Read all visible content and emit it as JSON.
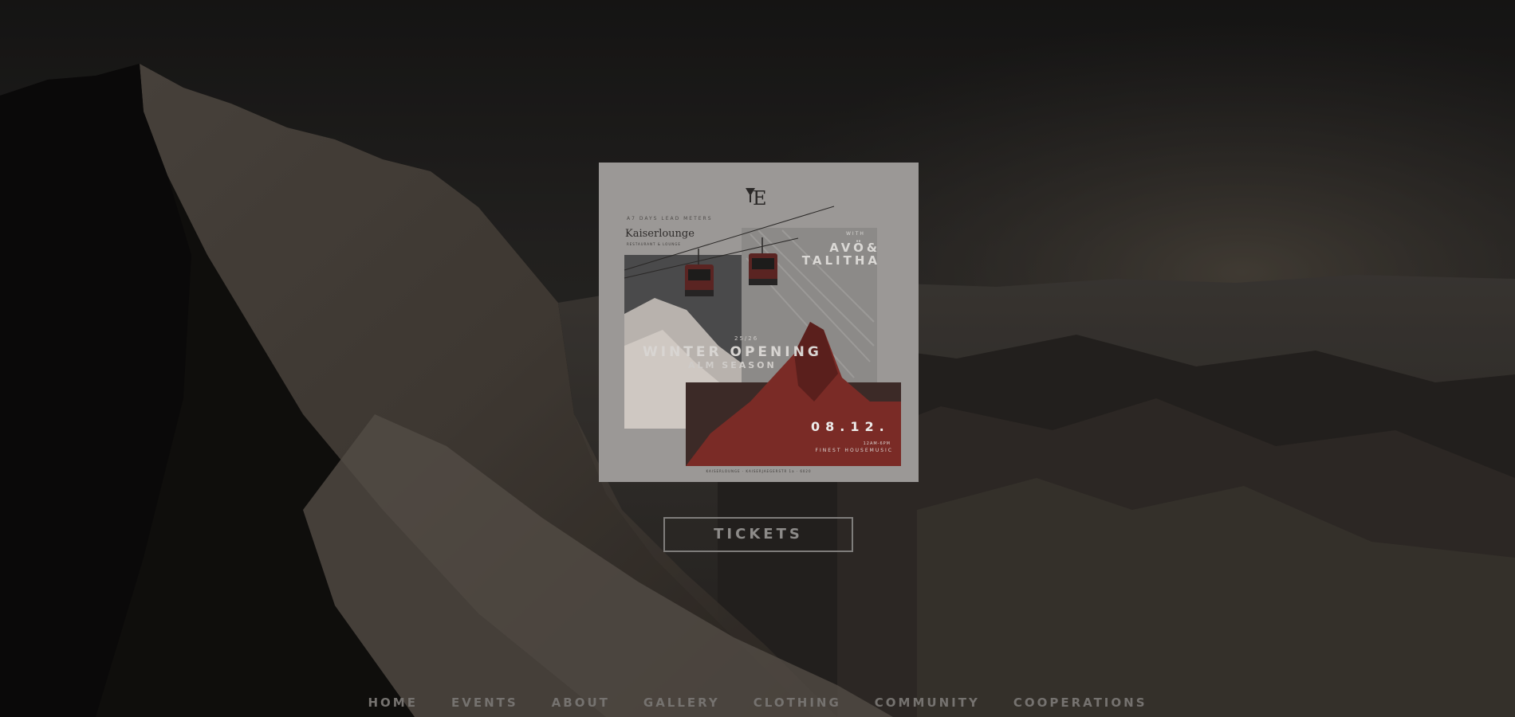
{
  "poster": {
    "kicker": "A7 DAYS LEAD METERS",
    "venue": "Kaiserlounge",
    "venue_sub": "RESTAURANT & LOUNGE",
    "with_label": "WITH",
    "artist_line1": "AVÖ&",
    "artist_line2": "TALITHA",
    "season_number": "25/26",
    "title": "WINTER OPENING",
    "subtitle": "ALM SEASON",
    "date": "08.12.",
    "time": "12AM-6PM",
    "tagline": "FINEST HOUSEMUSIC",
    "address": "KAISERLOUNGE · KAISERJAEGERSTR 1a · 6020"
  },
  "tickets_label": "TICKETS",
  "nav": {
    "items": [
      {
        "label": "HOME"
      },
      {
        "label": "EVENTS"
      },
      {
        "label": "ABOUT"
      },
      {
        "label": "GALLERY"
      },
      {
        "label": "CLOTHING"
      },
      {
        "label": "COMMUNITY"
      },
      {
        "label": "COOPERATIONS"
      }
    ]
  }
}
